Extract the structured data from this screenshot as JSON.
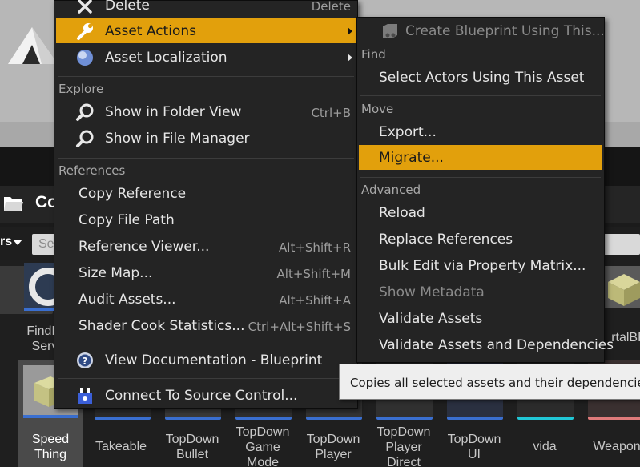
{
  "content_browser": {
    "title": "Co",
    "filters_label": "rs",
    "search_placeholder": "Se",
    "row1_captions": [
      "FindPl\nServ",
      "rtalBP"
    ],
    "assets": [
      {
        "name": "Speed\nThing",
        "selected": true
      },
      {
        "name": "Takeable"
      },
      {
        "name": "TopDown\nBullet"
      },
      {
        "name": "TopDown\nGame\nMode"
      },
      {
        "name": "TopDown\nPlayer"
      },
      {
        "name": "TopDown\nPlayer\nDirect"
      },
      {
        "name": "TopDown\nUI"
      },
      {
        "name": "vida"
      },
      {
        "name": "Weapons"
      }
    ]
  },
  "context_menu": {
    "items": {
      "delete": {
        "label": "Delete",
        "shortcut": "Delete",
        "icon": "close-icon"
      },
      "asset_actions": {
        "label": "Asset Actions",
        "icon": "wrench-icon",
        "highlighted": true,
        "has_submenu": true
      },
      "asset_localization": {
        "label": "Asset Localization",
        "icon": "globe-icon",
        "has_submenu": true
      },
      "show_folder": {
        "label": "Show in Folder View",
        "shortcut": "Ctrl+B",
        "icon": "magnifier-icon"
      },
      "show_file_manager": {
        "label": "Show in File Manager",
        "icon": "magnifier-icon"
      },
      "copy_reference": {
        "label": "Copy Reference"
      },
      "copy_file_path": {
        "label": "Copy File Path"
      },
      "reference_viewer": {
        "label": "Reference Viewer...",
        "shortcut": "Alt+Shift+R"
      },
      "size_map": {
        "label": "Size Map...",
        "shortcut": "Alt+Shift+M"
      },
      "audit_assets": {
        "label": "Audit Assets...",
        "shortcut": "Alt+Shift+A"
      },
      "shader_cook": {
        "label": "Shader Cook Statistics...",
        "shortcut": "Ctrl+Alt+Shift+S"
      },
      "view_docs": {
        "label": "View Documentation - Blueprint",
        "icon": "help-icon"
      },
      "source_control": {
        "label": "Connect To Source Control...",
        "icon": "source-control-icon"
      }
    },
    "sections": {
      "explore": "Explore",
      "references": "References"
    }
  },
  "submenu": {
    "items": {
      "create_blueprint": {
        "label": "Create Blueprint Using This...",
        "icon": "blueprint-icon",
        "disabled": true
      },
      "select_actors": {
        "label": "Select Actors Using This Asset"
      },
      "export": {
        "label": "Export..."
      },
      "migrate": {
        "label": "Migrate...",
        "highlighted": true
      },
      "reload": {
        "label": "Reload"
      },
      "replace_refs": {
        "label": "Replace References"
      },
      "bulk_edit": {
        "label": "Bulk Edit via Property Matrix..."
      },
      "show_metadata": {
        "label": "Show Metadata",
        "disabled": true
      },
      "validate_assets": {
        "label": "Validate Assets"
      },
      "validate_deps": {
        "label": "Validate Assets and Dependencies"
      }
    },
    "sections": {
      "find": "Find",
      "move": "Move",
      "advanced": "Advanced"
    }
  },
  "tooltip": {
    "text": "Copies all selected assets and their dependencies to"
  },
  "colors": {
    "highlight": "#e2a00c",
    "menu_bg": "#242424",
    "tooltip_bg": "#eeeeee"
  }
}
